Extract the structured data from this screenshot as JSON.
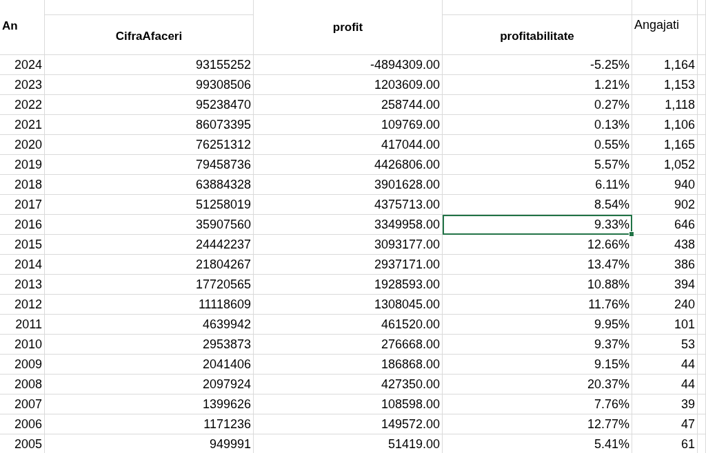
{
  "header": {
    "column_a": "An",
    "column_b": "CifraAfaceri",
    "column_c": "profit",
    "column_d": "profitabilitate",
    "column_e": "Angajati"
  },
  "rows": [
    {
      "cells": [
        {
          "text": "2024",
          "selected": false
        },
        {
          "text": "93155252",
          "selected": false
        },
        {
          "text": "-4894309.00",
          "selected": false
        },
        {
          "text": "-5.25%",
          "selected": false
        },
        {
          "text": "1,164",
          "selected": false
        }
      ]
    },
    {
      "cells": [
        {
          "text": "2023",
          "selected": false
        },
        {
          "text": "99308506",
          "selected": false
        },
        {
          "text": "1203609.00",
          "selected": false
        },
        {
          "text": "1.21%",
          "selected": false
        },
        {
          "text": "1,153",
          "selected": false
        }
      ]
    },
    {
      "cells": [
        {
          "text": "2022",
          "selected": false
        },
        {
          "text": "95238470",
          "selected": false
        },
        {
          "text": "258744.00",
          "selected": false
        },
        {
          "text": "0.27%",
          "selected": false
        },
        {
          "text": "1,118",
          "selected": false
        }
      ]
    },
    {
      "cells": [
        {
          "text": "2021",
          "selected": false
        },
        {
          "text": "86073395",
          "selected": false
        },
        {
          "text": "109769.00",
          "selected": false
        },
        {
          "text": "0.13%",
          "selected": false
        },
        {
          "text": "1,106",
          "selected": false
        }
      ]
    },
    {
      "cells": [
        {
          "text": "2020",
          "selected": false
        },
        {
          "text": "76251312",
          "selected": false
        },
        {
          "text": "417044.00",
          "selected": false
        },
        {
          "text": "0.55%",
          "selected": false
        },
        {
          "text": "1,165",
          "selected": false
        }
      ]
    },
    {
      "cells": [
        {
          "text": "2019",
          "selected": false
        },
        {
          "text": "79458736",
          "selected": false
        },
        {
          "text": "4426806.00",
          "selected": false
        },
        {
          "text": "5.57%",
          "selected": false
        },
        {
          "text": "1,052",
          "selected": false
        }
      ]
    },
    {
      "cells": [
        {
          "text": "2018",
          "selected": false
        },
        {
          "text": "63884328",
          "selected": false
        },
        {
          "text": "3901628.00",
          "selected": false
        },
        {
          "text": "6.11%",
          "selected": false
        },
        {
          "text": "940",
          "selected": false
        }
      ]
    },
    {
      "cells": [
        {
          "text": "2017",
          "selected": false
        },
        {
          "text": "51258019",
          "selected": false
        },
        {
          "text": "4375713.00",
          "selected": false
        },
        {
          "text": "8.54%",
          "selected": false
        },
        {
          "text": "902",
          "selected": false
        }
      ]
    },
    {
      "cells": [
        {
          "text": "2016",
          "selected": false
        },
        {
          "text": "35907560",
          "selected": false
        },
        {
          "text": "3349958.00",
          "selected": false
        },
        {
          "text": "9.33%",
          "selected": true
        },
        {
          "text": "646",
          "selected": false
        }
      ]
    },
    {
      "cells": [
        {
          "text": "2015",
          "selected": false
        },
        {
          "text": "24442237",
          "selected": false
        },
        {
          "text": "3093177.00",
          "selected": false
        },
        {
          "text": "12.66%",
          "selected": false
        },
        {
          "text": "438",
          "selected": false
        }
      ]
    },
    {
      "cells": [
        {
          "text": "2014",
          "selected": false
        },
        {
          "text": "21804267",
          "selected": false
        },
        {
          "text": "2937171.00",
          "selected": false
        },
        {
          "text": "13.47%",
          "selected": false
        },
        {
          "text": "386",
          "selected": false
        }
      ]
    },
    {
      "cells": [
        {
          "text": "2013",
          "selected": false
        },
        {
          "text": "17720565",
          "selected": false
        },
        {
          "text": "1928593.00",
          "selected": false
        },
        {
          "text": "10.88%",
          "selected": false
        },
        {
          "text": "394",
          "selected": false
        }
      ]
    },
    {
      "cells": [
        {
          "text": "2012",
          "selected": false
        },
        {
          "text": "11118609",
          "selected": false
        },
        {
          "text": "1308045.00",
          "selected": false
        },
        {
          "text": "11.76%",
          "selected": false
        },
        {
          "text": "240",
          "selected": false
        }
      ]
    },
    {
      "cells": [
        {
          "text": "2011",
          "selected": false
        },
        {
          "text": "4639942",
          "selected": false
        },
        {
          "text": "461520.00",
          "selected": false
        },
        {
          "text": "9.95%",
          "selected": false
        },
        {
          "text": "101",
          "selected": false
        }
      ]
    },
    {
      "cells": [
        {
          "text": "2010",
          "selected": false
        },
        {
          "text": "2953873",
          "selected": false
        },
        {
          "text": "276668.00",
          "selected": false
        },
        {
          "text": "9.37%",
          "selected": false
        },
        {
          "text": "53",
          "selected": false
        }
      ]
    },
    {
      "cells": [
        {
          "text": "2009",
          "selected": false
        },
        {
          "text": "2041406",
          "selected": false
        },
        {
          "text": "186868.00",
          "selected": false
        },
        {
          "text": "9.15%",
          "selected": false
        },
        {
          "text": "44",
          "selected": false
        }
      ]
    },
    {
      "cells": [
        {
          "text": "2008",
          "selected": false
        },
        {
          "text": "2097924",
          "selected": false
        },
        {
          "text": "427350.00",
          "selected": false
        },
        {
          "text": "20.37%",
          "selected": false
        },
        {
          "text": "44",
          "selected": false
        }
      ]
    },
    {
      "cells": [
        {
          "text": "2007",
          "selected": false
        },
        {
          "text": "1399626",
          "selected": false
        },
        {
          "text": "108598.00",
          "selected": false
        },
        {
          "text": "7.76%",
          "selected": false
        },
        {
          "text": "39",
          "selected": false
        }
      ]
    },
    {
      "cells": [
        {
          "text": "2006",
          "selected": false
        },
        {
          "text": "1171236",
          "selected": false
        },
        {
          "text": "149572.00",
          "selected": false
        },
        {
          "text": "12.77%",
          "selected": false
        },
        {
          "text": "47",
          "selected": false
        }
      ]
    },
    {
      "cells": [
        {
          "text": "2005",
          "selected": false
        },
        {
          "text": "949991",
          "selected": false
        },
        {
          "text": "51419.00",
          "selected": false
        },
        {
          "text": "5.41%",
          "selected": false
        },
        {
          "text": "61",
          "selected": false
        }
      ]
    }
  ]
}
